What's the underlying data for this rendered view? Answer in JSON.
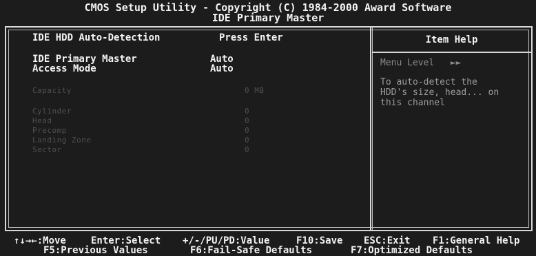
{
  "header": {
    "title": "CMOS Setup Utility - Copyright (C) 1984-2000 Award Software",
    "subtitle": "IDE Primary Master"
  },
  "settings": [
    {
      "label": "IDE HDD Auto-Detection",
      "value": "Press Enter"
    },
    {
      "label": "IDE Primary Master",
      "value": "Auto"
    },
    {
      "label": "Access Mode",
      "value": "Auto"
    }
  ],
  "dimmed": {
    "capacity": {
      "label": "Capacity",
      "value": "0 MB"
    },
    "cylinder": {
      "label": "Cylinder",
      "value": "0"
    },
    "head": {
      "label": "Head",
      "value": "0"
    },
    "precomp": {
      "label": "Precomp",
      "value": "0"
    },
    "landing_zone": {
      "label": "Landing Zone",
      "value": "0"
    },
    "sector": {
      "label": "Sector",
      "value": "0"
    }
  },
  "help": {
    "title": "Item Help",
    "menu_level": "Menu Level   ►►",
    "desc_lines": [
      "To auto-detect the",
      "HDD's size, head... on",
      "this channel"
    ]
  },
  "footer": {
    "move": "↑↓→←:Move",
    "select": "Enter:Select",
    "value": "+/-/PU/PD:Value",
    "save": "F10:Save",
    "exit": "ESC:Exit",
    "help": "F1:General Help",
    "prev": "F5:Previous Values",
    "failsafe": "F6:Fail-Safe Defaults",
    "optimized": "F7:Optimized Defaults"
  },
  "colors": {
    "background": "#1c1c1c",
    "text": "#ededed",
    "dim_text": "#4f4f4f",
    "help_text": "#9c9c9c"
  }
}
